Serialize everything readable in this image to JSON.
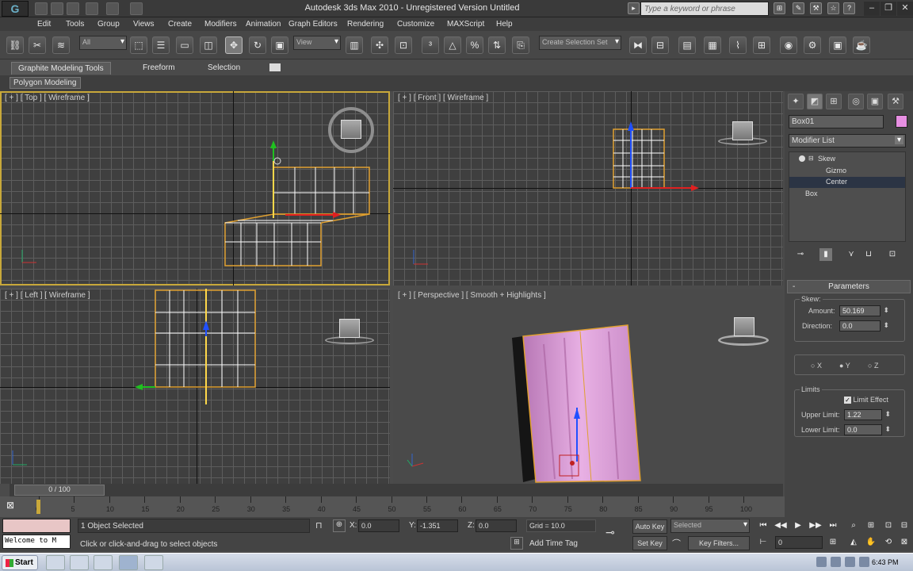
{
  "titlebar": {
    "title": "Autodesk 3ds Max  2010   -   Unregistered Version    Untitled",
    "search_placeholder": "Type a keyword or phrase",
    "logo": "G",
    "window_controls": [
      "–",
      "❐",
      "✕"
    ]
  },
  "menu": [
    "Edit",
    "Tools",
    "Group",
    "Views",
    "Create",
    "Modifiers",
    "Animation",
    "Graph Editors",
    "Rendering",
    "Customize",
    "MAXScript",
    "Help"
  ],
  "toolbar": {
    "filter_value": "All",
    "ref_coord_value": "View",
    "selection_set_placeholder": "Create Selection Set"
  },
  "ribbon": {
    "tabs": [
      "Graphite Modeling Tools",
      "Freeform",
      "Selection"
    ],
    "sub_tab": "Polygon Modeling"
  },
  "viewports": {
    "top": "[ + ] [ Top ] [ Wireframe ]",
    "front": "[ + ] [ Front ] [ Wireframe ]",
    "left": "[ + ] [ Left ] [ Wireframe ]",
    "perspective": "[ + ] [ Perspective ] [ Smooth + Highlights ]"
  },
  "command_panel": {
    "object_name": "Box01",
    "object_color": "#e78fe2",
    "modifier_list": "Modifier List",
    "stack": {
      "skew": "Skew",
      "gizmo": "Gizmo",
      "center": "Center",
      "box": "Box"
    },
    "parameters": {
      "title": "Parameters",
      "skew_group": "Skew:",
      "amount_label": "Amount:",
      "amount_value": "50.169",
      "direction_label": "Direction:",
      "direction_value": "0.0",
      "axes": [
        "X",
        "Y",
        "Z"
      ],
      "selected_axis": "Y",
      "limits_group": "Limits",
      "limit_effect_label": "Limit Effect",
      "limit_effect_checked": true,
      "upper_label": "Upper Limit:",
      "upper_value": "1.22",
      "lower_label": "Lower Limit:",
      "lower_value": "0.0"
    }
  },
  "timeline": {
    "slider": "0 / 100",
    "ticks": [
      "0",
      "5",
      "10",
      "15",
      "20",
      "25",
      "30",
      "35",
      "40",
      "45",
      "50",
      "55",
      "60",
      "65",
      "70",
      "75",
      "80",
      "85",
      "90",
      "95",
      "100"
    ],
    "current_frame": 0
  },
  "status": {
    "selection": "1 Object Selected",
    "prompt": "Click or click-and-drag to select objects",
    "listener": "Welcome to M",
    "x_label": "X:",
    "x_value": "0.0",
    "y_label": "Y:",
    "y_value": "-1.351",
    "z_label": "Z:",
    "z_value": "0.0",
    "grid": "Grid = 10.0",
    "add_time_tag": "Add Time Tag",
    "auto_key": "Auto Key",
    "set_key": "Set Key",
    "key_mode": "Selected",
    "key_filters": "Key Filters...",
    "frame": "0"
  },
  "taskbar": {
    "start": "Start",
    "clock": "6:43 PM"
  },
  "colors": {
    "selection_highlight": "#c8a83a",
    "x_axis": "#e02020",
    "y_axis": "#20c020",
    "z_axis": "#2050ff",
    "mesh_pink": "#e3a6e0"
  }
}
